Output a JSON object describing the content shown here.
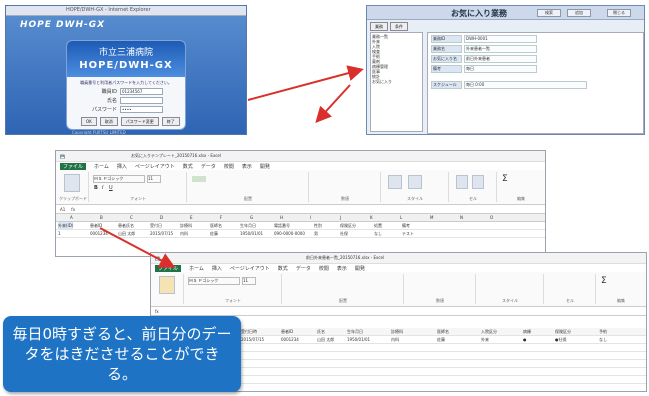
{
  "login": {
    "titlebar": "HOPE/DWH-GX - Internet Explorer",
    "brand": "HOPE DWH-GX",
    "hospital": "市立三浦病院",
    "system": "HOPE/DWH-GX",
    "message": "職員番号と利用者パスワードを入力してください。",
    "fields": [
      {
        "label": "職員ID",
        "value": "01234567"
      },
      {
        "label": "氏名",
        "value": ""
      },
      {
        "label": "パスワード",
        "value": "••••"
      }
    ],
    "buttons": [
      "OK",
      "取消",
      "パスワード変更",
      "終了"
    ],
    "copyright": "Copyright FUJITSU LIMITED"
  },
  "favorites": {
    "title": "お気に入り業務",
    "buttons": [
      "検索",
      "追加",
      "閉じる"
    ],
    "tabs": [
      "業務",
      "条件"
    ],
    "tree": [
      "業務一覧",
      "外来",
      "入院",
      "検査",
      "手術",
      "薬剤",
      "病棟管理",
      "医事",
      "統計",
      "お気に入り"
    ],
    "form": [
      {
        "key": "業務ID",
        "value": "DWH-0001"
      },
      {
        "key": "業務名",
        "value": "外来患者一覧"
      },
      {
        "key": "お気に入り名",
        "value": "前日外来患者"
      },
      {
        "key": "備考",
        "value": "毎日"
      },
      {
        "key": "スケジュール",
        "value": "毎日 0:00"
      }
    ]
  },
  "excel1": {
    "title": "お気に入りテンプレート_20150716.xlsx - Excel",
    "menu": [
      "ファイル",
      "ホーム",
      "挿入",
      "ページレイアウト",
      "数式",
      "データ",
      "校閲",
      "表示",
      "開発"
    ],
    "font": "ＭＳ Ｐゴシック",
    "font_size": "11",
    "groups": [
      "クリップボード",
      "フォント",
      "配置",
      "数値",
      "スタイル",
      "セル",
      "編集"
    ],
    "cell_ref": "A1",
    "columns": [
      "A",
      "B",
      "C",
      "D",
      "E",
      "F",
      "G",
      "H",
      "I",
      "J",
      "K",
      "L",
      "M",
      "N",
      "O"
    ],
    "header_row": [
      "外来(ID)",
      "患者ID",
      "患者氏名",
      "受付日",
      "診療科",
      "医師名",
      "生年月日",
      "電話番号",
      "性別",
      "保険区分",
      "処置",
      "備考"
    ],
    "data_row": [
      "1",
      "0001234",
      "山田 太郎",
      "2015/07/15",
      "内科",
      "佐藤",
      "1950/01/01",
      "090-0000-0000",
      "男",
      "社保",
      "なし",
      "テスト"
    ]
  },
  "excel2": {
    "title": "前日外来患者一覧_20150716.xlsx - Excel",
    "menu": [
      "ファイル",
      "ホーム",
      "挿入",
      "ページレイアウト",
      "数式",
      "データ",
      "校閲",
      "表示",
      "開発"
    ],
    "font": "ＭＳ Ｐゴシック",
    "font_size": "11",
    "groups": [
      "フォント",
      "配置",
      "数値",
      "スタイル",
      "セル",
      "編集"
    ],
    "header_row": [
      "受付日時",
      "患者ID",
      "氏名",
      "生年月日",
      "診療科",
      "医師名",
      "入院区分",
      "病棟",
      "保険区分",
      "予約"
    ],
    "data_row": [
      "2015/07/15",
      "0001234",
      "山田 太郎",
      "1950/01/01",
      "内科",
      "佐藤",
      "外来",
      "●",
      "●社保",
      "なし"
    ]
  },
  "callout": {
    "text": "毎日0時すぎると、前日分のデータをはきださせることができる。"
  },
  "colors": {
    "callout_bg": "#1f73c4",
    "arrow": "#d9302b",
    "excel_green": "#217346"
  }
}
